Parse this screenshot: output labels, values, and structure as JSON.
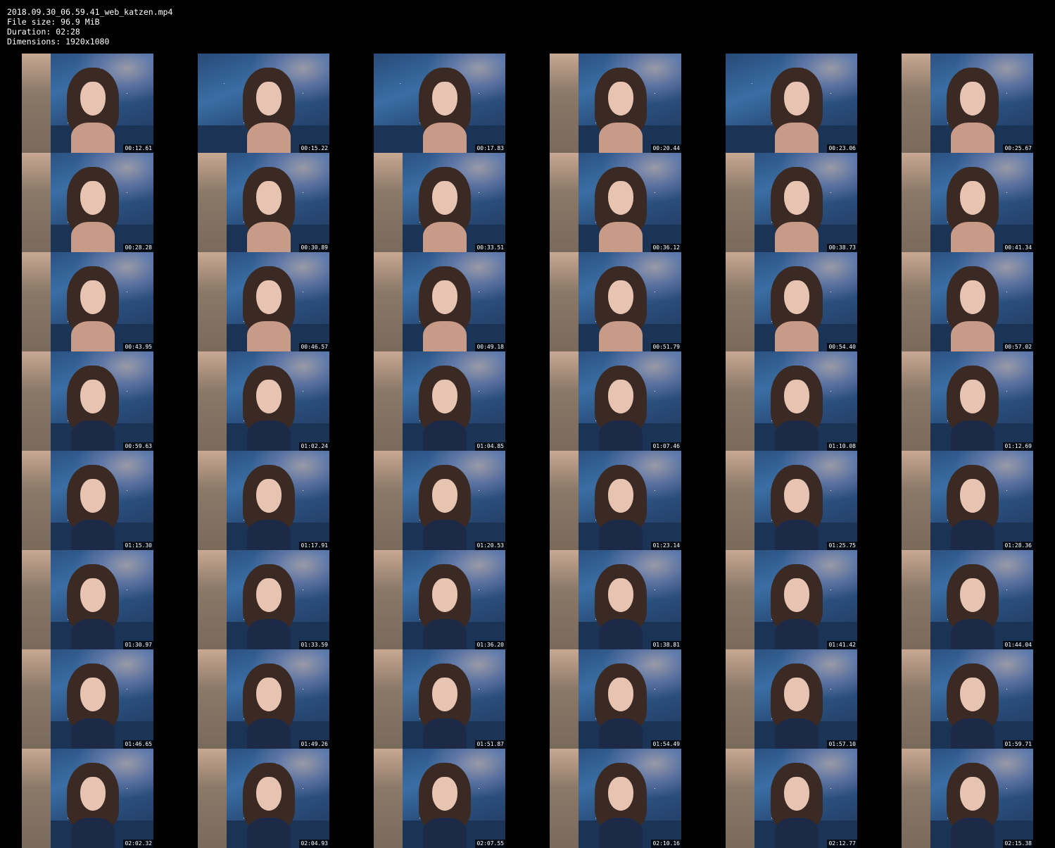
{
  "header": {
    "filename": "2018.09.30_06.59.41_web_katzen.mp4",
    "filesize": "File size: 96.9 MiB",
    "duration": "Duration: 02:28",
    "dimensions": "Dimensions: 1920x1080"
  },
  "thumbnails": [
    "00:12.61",
    "00:15.22",
    "00:17.83",
    "00:20.44",
    "00:23.06",
    "00:25.67",
    "00:28.28",
    "00:30.89",
    "00:33.51",
    "00:36.12",
    "00:38.73",
    "00:41.34",
    "00:43.95",
    "00:46.57",
    "00:49.18",
    "00:51.79",
    "00:54.40",
    "00:57.02",
    "00:59.63",
    "01:02.24",
    "01:04.85",
    "01:07.46",
    "01:10.08",
    "01:12.69",
    "01:15.30",
    "01:17.91",
    "01:20.53",
    "01:23.14",
    "01:25.75",
    "01:28.36",
    "01:30.97",
    "01:33.59",
    "01:36.20",
    "01:38.81",
    "01:41.42",
    "01:44.04",
    "01:46.65",
    "01:49.26",
    "01:51.87",
    "01:54.49",
    "01:57.10",
    "01:59.71",
    "02:02.32",
    "02:04.93",
    "02:07.55",
    "02:10.16",
    "02:12.77",
    "02:15.38"
  ],
  "colors": {
    "background": "#000000",
    "text": "#ffffff"
  }
}
